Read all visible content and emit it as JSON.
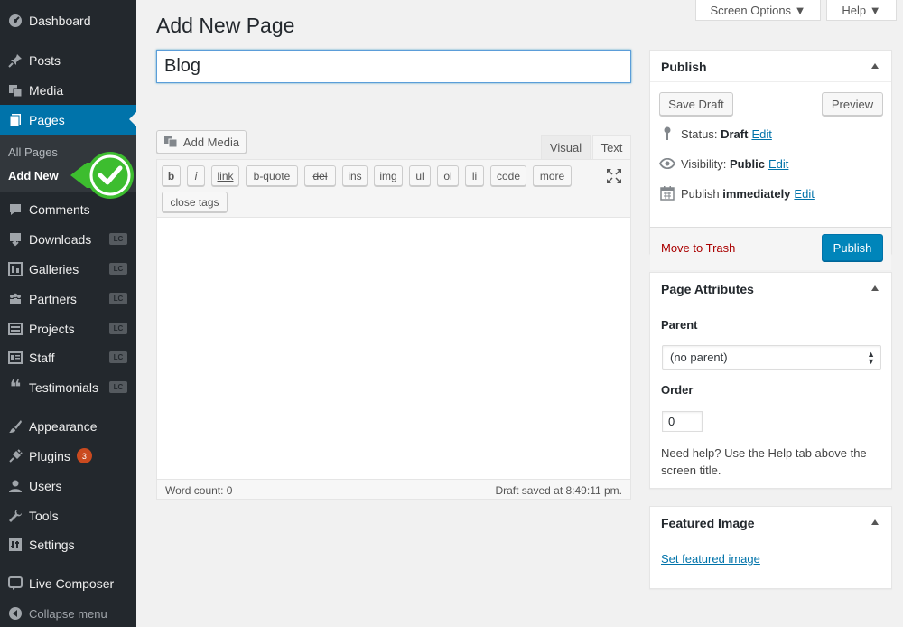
{
  "sidebar": {
    "items": [
      {
        "label": "Dashboard",
        "icon": "dashboard-icon"
      },
      {
        "label": "Posts",
        "icon": "pin-icon"
      },
      {
        "label": "Media",
        "icon": "media-icon"
      },
      {
        "label": "Pages",
        "icon": "page-icon"
      },
      {
        "label": "Comments",
        "icon": "comment-icon"
      },
      {
        "label": "Downloads",
        "icon": "download-icon",
        "badge": "LC"
      },
      {
        "label": "Galleries",
        "icon": "gallery-icon",
        "badge": "LC"
      },
      {
        "label": "Partners",
        "icon": "groups-icon",
        "badge": "LC"
      },
      {
        "label": "Projects",
        "icon": "projects-icon",
        "badge": "LC"
      },
      {
        "label": "Staff",
        "icon": "id-card-icon",
        "badge": "LC"
      },
      {
        "label": "Testimonials",
        "icon": "quote-icon",
        "badge": "LC"
      },
      {
        "label": "Appearance",
        "icon": "brush-icon"
      },
      {
        "label": "Plugins",
        "icon": "plugin-icon",
        "count": "3"
      },
      {
        "label": "Users",
        "icon": "user-icon"
      },
      {
        "label": "Tools",
        "icon": "wrench-icon"
      },
      {
        "label": "Settings",
        "icon": "settings-icon"
      },
      {
        "label": "Live Composer",
        "icon": "live-composer-icon"
      }
    ],
    "submenu": [
      "All Pages",
      "Add New"
    ],
    "collapse_label": "Collapse menu"
  },
  "header": {
    "title": "Add New Page",
    "screen_options": "Screen Options ▼",
    "help": "Help ▼"
  },
  "editor": {
    "title_value": "Blog",
    "add_media": "Add Media",
    "tab_visual": "Visual",
    "tab_text": "Text",
    "quicktags": [
      "b",
      "i",
      "link",
      "b-quote",
      "del",
      "ins",
      "img",
      "ul",
      "ol",
      "li",
      "code",
      "more"
    ],
    "close_tags": "close tags",
    "word_count": "Word count: 0",
    "draft_saved": "Draft saved at 8:49:11 pm."
  },
  "publish": {
    "title": "Publish",
    "save_draft": "Save Draft",
    "preview": "Preview",
    "status_label": "Status:",
    "status_value": "Draft",
    "visibility_label": "Visibility:",
    "visibility_value": "Public",
    "publish_label": "Publish",
    "publish_value": "immediately",
    "edit": "Edit",
    "trash": "Move to Trash",
    "publish_button": "Publish"
  },
  "page_attributes": {
    "title": "Page Attributes",
    "parent_label": "Parent",
    "parent_value": "(no parent)",
    "order_label": "Order",
    "order_value": "0",
    "help": "Need help? Use the Help tab above the screen title."
  },
  "featured_image": {
    "title": "Featured Image",
    "link": "Set featured image"
  },
  "colors": {
    "accent": "#0073aa",
    "sidebar": "#23282d",
    "check": "#3dbd2f"
  }
}
